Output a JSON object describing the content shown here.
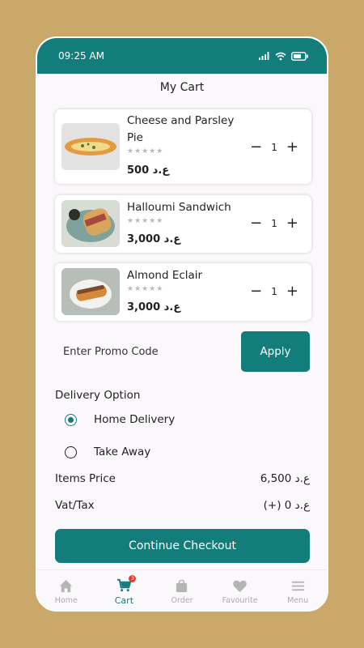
{
  "status": {
    "time": "09:25 AM"
  },
  "page_title": "My Cart",
  "items": [
    {
      "name": "Cheese and Parsley Pie",
      "stars": "★★★★★",
      "price": "500 ع.د",
      "qty": "1"
    },
    {
      "name": "Halloumi Sandwich",
      "stars": "★★★★★",
      "price": "3,000 ع.د",
      "qty": "1"
    },
    {
      "name": "Almond Eclair",
      "stars": "★★★★★",
      "price": "3,000 ع.د",
      "qty": "1"
    }
  ],
  "qty_controls": {
    "minus": "−",
    "plus": "+"
  },
  "promo": {
    "placeholder": "Enter Promo Code",
    "apply_label": "Apply"
  },
  "delivery": {
    "title": "Delivery Option",
    "options": [
      {
        "label": "Home Delivery",
        "selected": true
      },
      {
        "label": "Take Away",
        "selected": false
      }
    ]
  },
  "summary": {
    "items_price_label": "Items Price",
    "items_price_value": "6,500 ع.د",
    "vat_label": "Vat/Tax",
    "vat_value": "(+) 0 ع.د"
  },
  "checkout_label": "Continue Checkout",
  "nav": {
    "items": [
      {
        "label": "Home",
        "icon": "home-icon"
      },
      {
        "label": "Cart",
        "icon": "cart-icon",
        "badge": "3"
      },
      {
        "label": "Order",
        "icon": "bag-icon"
      },
      {
        "label": "Favourite",
        "icon": "heart-icon"
      },
      {
        "label": "Menu",
        "icon": "menu-icon"
      }
    ]
  },
  "colors": {
    "primary": "#137d7c",
    "background": "#c9a86a",
    "badge": "#e53935"
  }
}
